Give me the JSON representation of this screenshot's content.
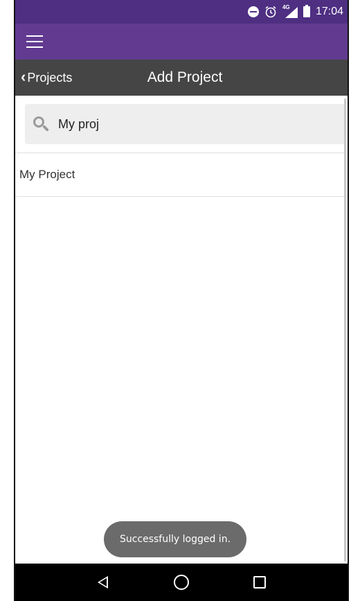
{
  "status_bar": {
    "time": "17:04",
    "network_label": "4G",
    "icons": [
      "do-not-disturb-icon",
      "alarm-icon",
      "signal-icon",
      "battery-icon"
    ]
  },
  "app_bar": {
    "menu_icon": "menu-icon",
    "color": "#623b91"
  },
  "nav_bar": {
    "back_label": "Projects",
    "title": "Add Project"
  },
  "search": {
    "value": "My proj",
    "icon": "search-icon"
  },
  "results": [
    {
      "label": "My Project"
    }
  ],
  "toast": {
    "message": "Successfully logged in."
  },
  "system_nav": {
    "keys": [
      "back-icon",
      "home-icon",
      "recents-icon"
    ]
  }
}
